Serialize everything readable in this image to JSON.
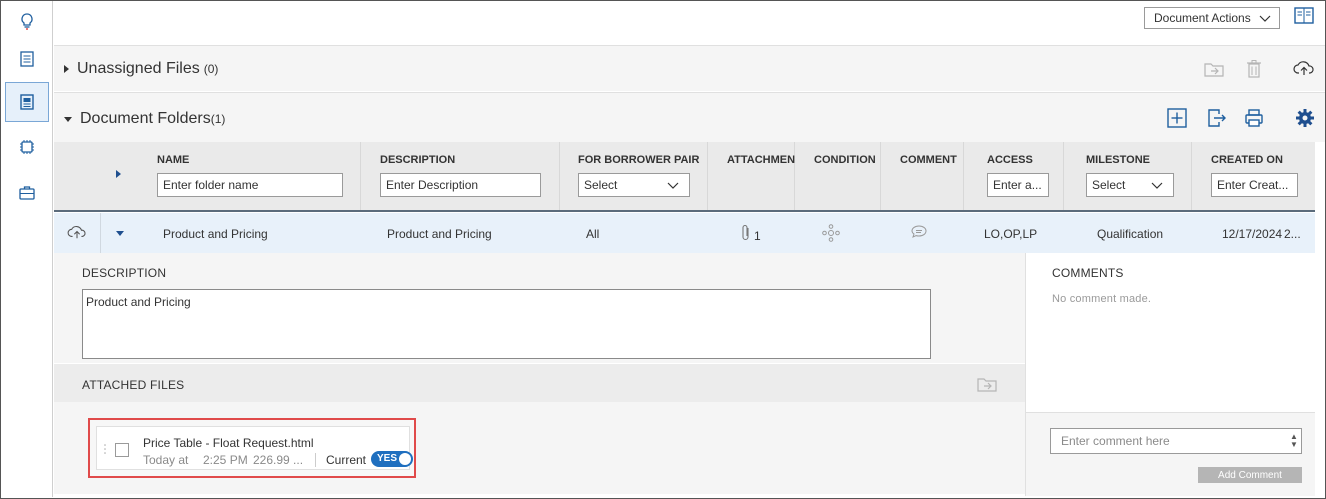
{
  "header": {
    "document_actions_label": "Document Actions"
  },
  "sidebar": {
    "items": [
      {
        "icon": "lightbulb-icon"
      },
      {
        "icon": "list-icon"
      },
      {
        "icon": "document-icon",
        "active": true
      },
      {
        "icon": "chip-icon"
      },
      {
        "icon": "briefcase-icon"
      }
    ]
  },
  "unassigned": {
    "title": "Unassigned Files",
    "count": "(0)"
  },
  "folders": {
    "title": "Document Folders",
    "count": "(1)"
  },
  "grid": {
    "columns": {
      "name": {
        "header": "NAME",
        "placeholder": "Enter folder name"
      },
      "description": {
        "header": "DESCRIPTION",
        "placeholder": "Enter Description"
      },
      "borrower_pair": {
        "header": "FOR BORROWER PAIR",
        "select": "Select"
      },
      "attachments": {
        "header": "ATTACHMEN"
      },
      "condition": {
        "header": "CONDITION"
      },
      "comment": {
        "header": "COMMENT"
      },
      "access": {
        "header": "ACCESS",
        "placeholder": "Enter a..."
      },
      "milestone": {
        "header": "MILESTONE",
        "select": "Select"
      },
      "created_on": {
        "header": "CREATED ON",
        "placeholder": "Enter Creat..."
      }
    },
    "row": {
      "name": "Product and Pricing",
      "description": "Product and Pricing",
      "borrower_pair": "All",
      "attachments": "1",
      "access": "LO,OP,LP",
      "milestone": "Qualification",
      "created_on": "12/17/2024",
      "created_on_overflow": "2..."
    }
  },
  "detail": {
    "description_label": "DESCRIPTION",
    "description_value": "Product and Pricing",
    "attached_files_label": "ATTACHED FILES",
    "file": {
      "name": "Price Table - Float Request.html",
      "date": "Today at",
      "time": "2:25 PM",
      "size": "226.99 ...",
      "current_label": "Current",
      "toggle_label": "YES"
    }
  },
  "comments": {
    "label": "COMMENTS",
    "empty": "No comment made.",
    "placeholder": "Enter comment here",
    "add_label": "Add Comment"
  },
  "colors": {
    "accent": "#1f6fbf",
    "highlight_border": "#e04a4a",
    "row_selected": "#e8f1fa"
  }
}
